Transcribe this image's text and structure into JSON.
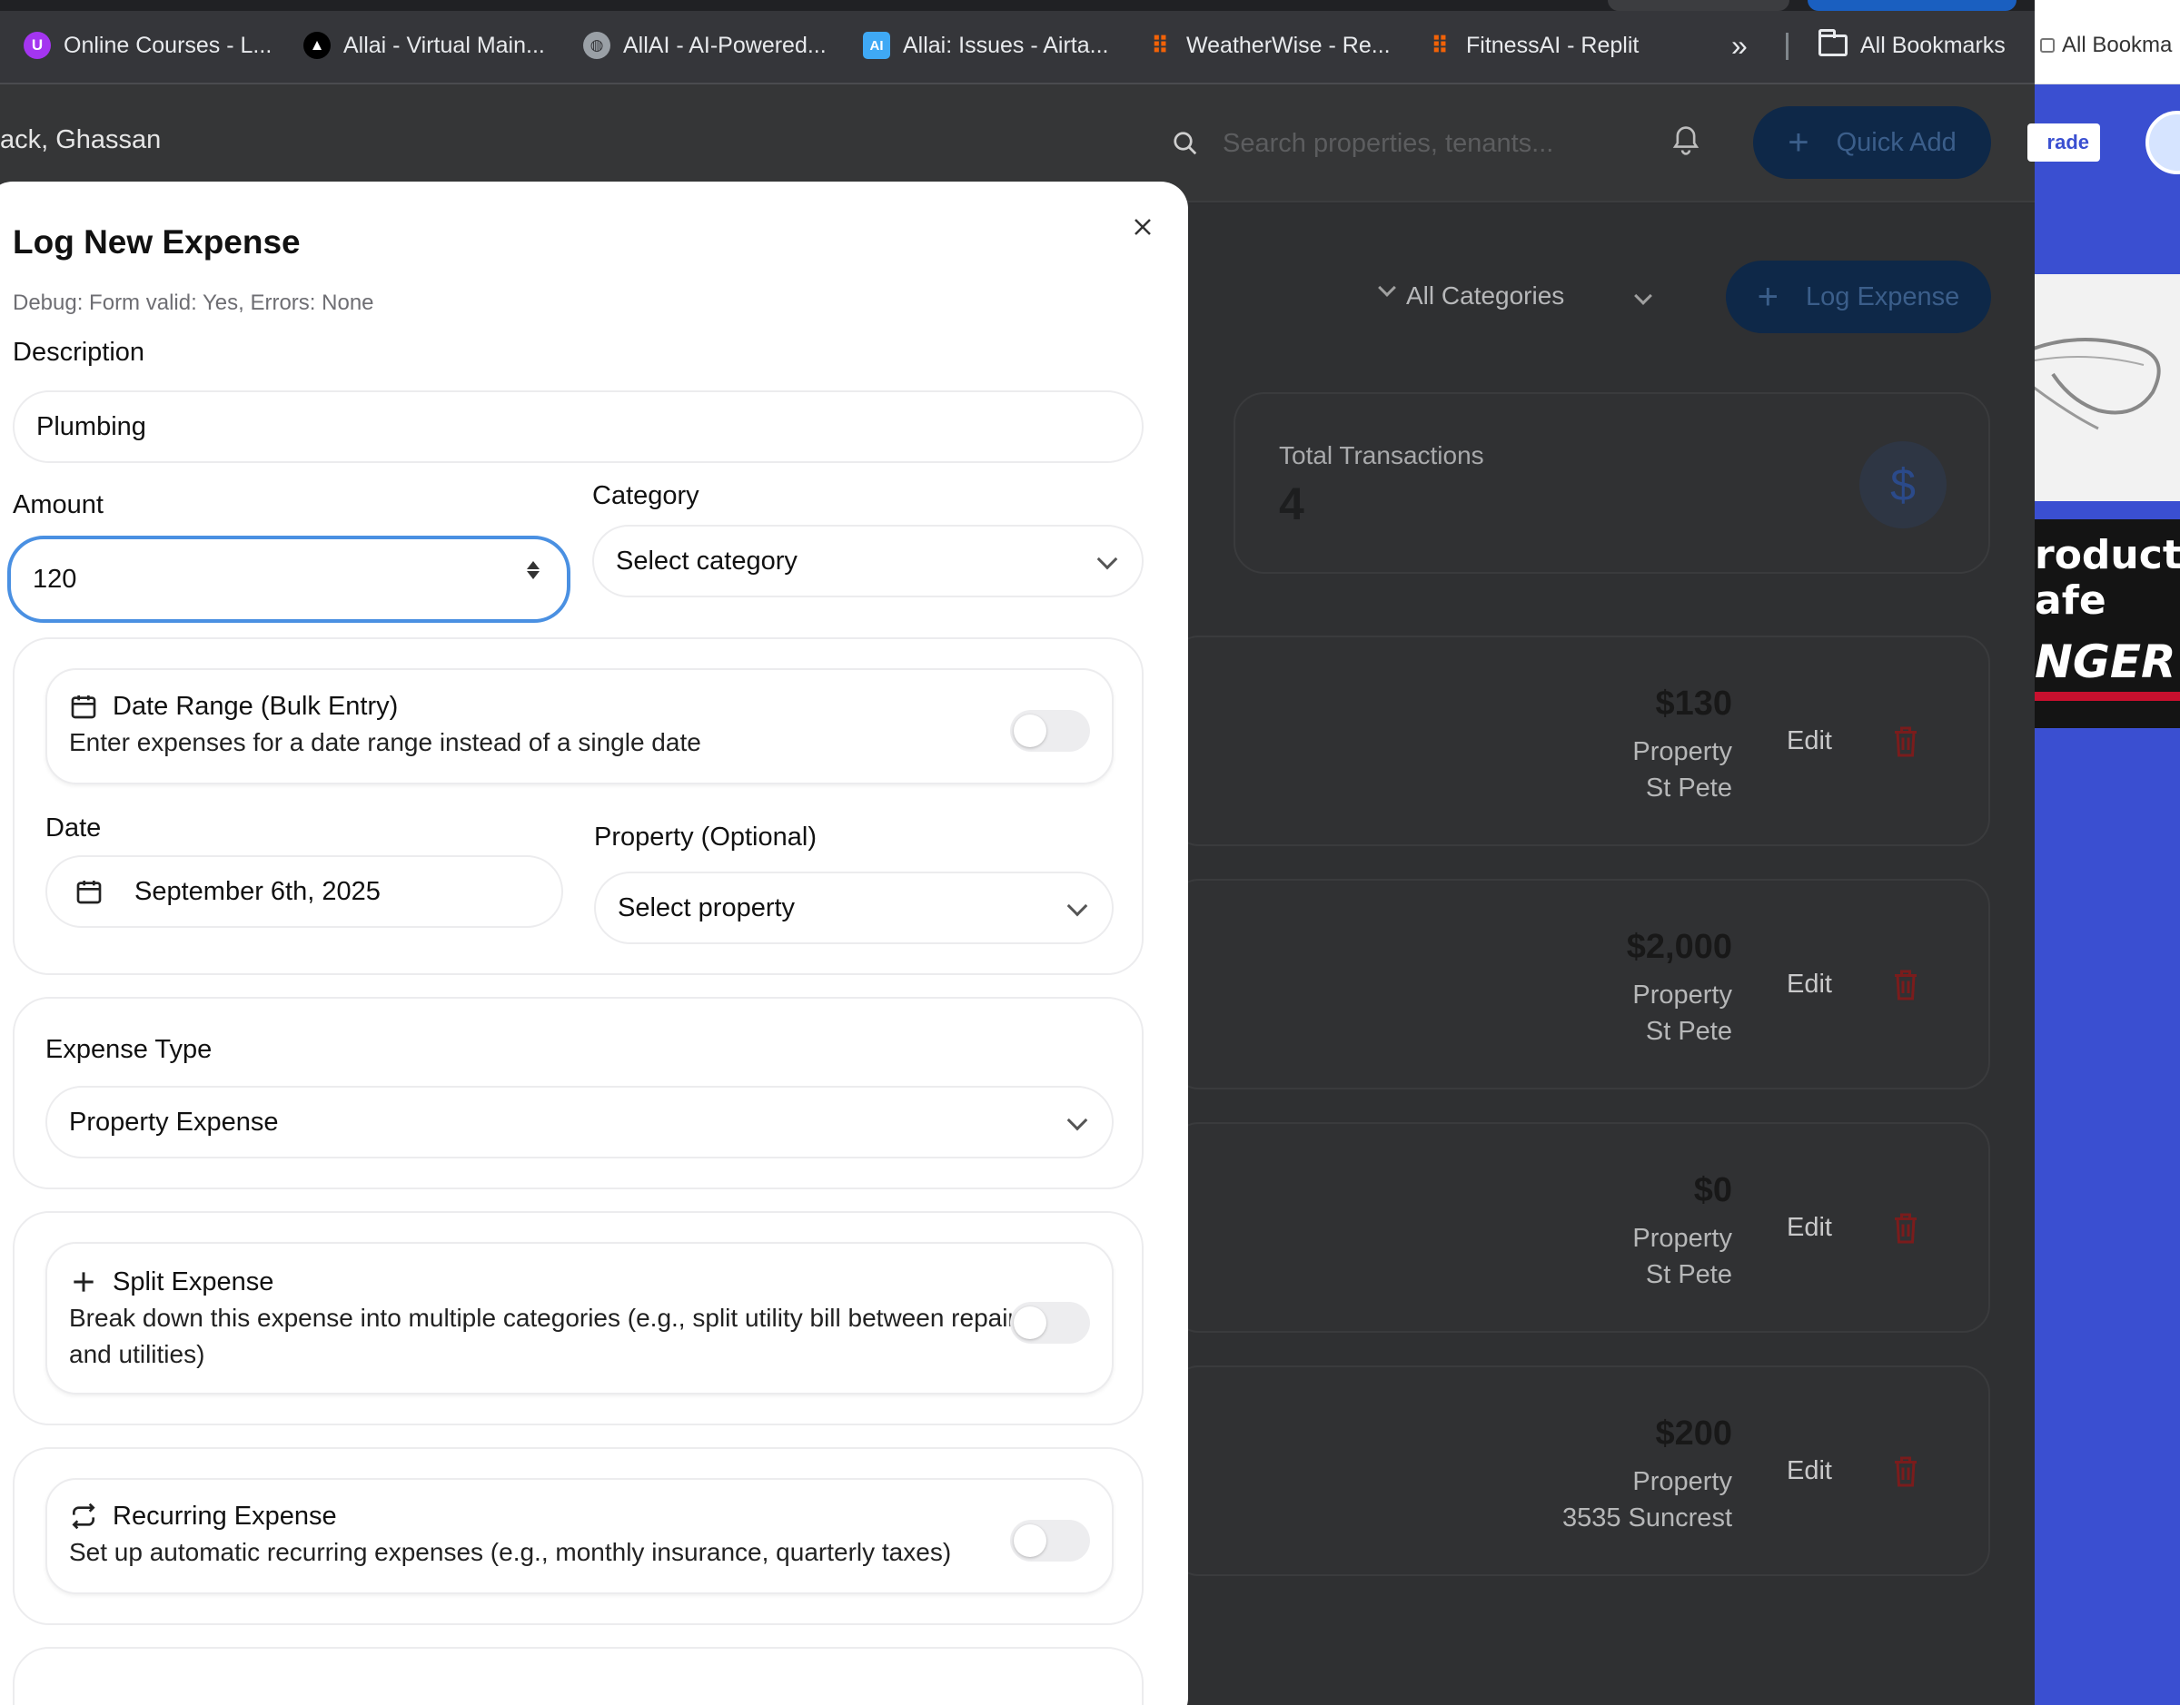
{
  "browser": {
    "bookmarks": [
      {
        "label": "Online Courses - L...",
        "icon": "udemy-icon",
        "color": "#a435f0"
      },
      {
        "label": "Allai - Virtual Main...",
        "icon": "triangle-logo-icon",
        "color": "#000000"
      },
      {
        "label": "AllAI - AI-Powered...",
        "icon": "globe-icon",
        "color": "#9aa0a6"
      },
      {
        "label": "Allai: Issues - Airta...",
        "icon": "ai-badge-icon",
        "color": "#3fa9f5"
      },
      {
        "label": "WeatherWise - Re...",
        "icon": "replit-icon",
        "color": "#f26207"
      },
      {
        "label": "FitnessAI - Replit",
        "icon": "replit-icon",
        "color": "#f26207"
      }
    ],
    "overflow_label": "»",
    "all_bookmarks_label": "All Bookmarks",
    "side_window_bookmarks_label": "All Bookma"
  },
  "app_header": {
    "user_name": "ack, Ghassan",
    "search_placeholder": "Search properties, tenants...",
    "quick_add_label": "Quick Add",
    "quick_add_icon": "+"
  },
  "background": {
    "filters": [
      "",
      "All Categories"
    ],
    "log_expense_label": "Log Expense",
    "log_expense_icon": "+",
    "total_transactions_label": "Total Transactions",
    "total_transactions_value": "4",
    "dollar_symbol": "$",
    "expenses": [
      {
        "amount": "$130",
        "type": "Property",
        "property": "St Pete",
        "edit": "Edit"
      },
      {
        "amount": "$2,000",
        "type": "Property",
        "property": "St Pete",
        "edit": "Edit"
      },
      {
        "amount": "$0",
        "type": "Property",
        "property": "St Pete",
        "edit": "Edit"
      },
      {
        "amount": "$200",
        "type": "Property",
        "property": "3535 Suncrest",
        "edit": "Edit"
      }
    ]
  },
  "side_window": {
    "upgrade_label": "rade",
    "ad_line1": "roducts",
    "ad_line2": "afe",
    "ad_brand": "NGER"
  },
  "modal": {
    "title": "Log New Expense",
    "debug": "Debug: Form valid: Yes, Errors: None",
    "description_label": "Description",
    "description_value": "Plumbing",
    "amount_label": "Amount",
    "amount_value": "120",
    "category_label": "Category",
    "category_value": "Select category",
    "date_range": {
      "title": "Date Range (Bulk Entry)",
      "description": "Enter expenses for a date range instead of a single date",
      "enabled": false
    },
    "date_label": "Date",
    "date_value": "September 6th, 2025",
    "property_label": "Property (Optional)",
    "property_value": "Select property",
    "expense_type_label": "Expense Type",
    "expense_type_value": "Property Expense",
    "split": {
      "title": "Split Expense",
      "description": "Break down this expense into multiple categories (e.g., split utility bill between repairs and utilities)",
      "enabled": false
    },
    "recurring": {
      "title": "Recurring Expense",
      "description": "Set up automatic recurring expenses (e.g., monthly insurance, quarterly taxes)",
      "enabled": false
    }
  },
  "colors": {
    "focus_ring": "#4a90e2",
    "primary_dimmed": "#0e2848",
    "delete_red": "#8b1a1a",
    "side_blue": "#3a4fd1"
  }
}
